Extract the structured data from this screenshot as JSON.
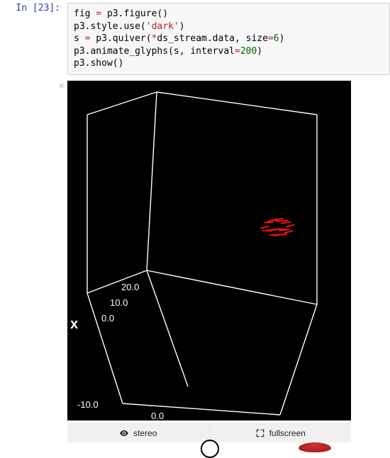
{
  "cell": {
    "prompt_in": "In ",
    "prompt_num": "23",
    "code": {
      "line1_a": "fig ",
      "line1_op": "=",
      "line1_b": " p3.figure()",
      "line2_a": "p3.style.use(",
      "line2_str": "'dark'",
      "line2_b": ")",
      "line3_a": "s ",
      "line3_op1": "=",
      "line3_b": " p3.quiver(",
      "line3_star": "*",
      "line3_c": "ds_stream.data, size",
      "line3_op2": "=",
      "line3_num": "6",
      "line3_d": ")",
      "line4_a": "p3.animate_glyphs(s, interval",
      "line4_op": "=",
      "line4_num": "200",
      "line4_b": ")",
      "line5": "p3.show()"
    }
  },
  "output": {
    "close_symbol": "×",
    "axis_ticks": {
      "t20": "20.0",
      "t10": "10.0",
      "t0": "0.0",
      "tm10": "-10.0",
      "bottom0": "0.0"
    },
    "axis_letter_x": "x",
    "toolbar": {
      "stereo": "stereo",
      "fullscreen": "fullscreen"
    }
  },
  "chart_data": {
    "type": "other",
    "description": "3D quiver/vector glyph plot (ipyvolume) on black background, dark style. A tight red cluster of small arrow glyphs near center-right of a white wireframe bounding cube. Visible axis tick labels along one edge: -10.0, 0.0, 10.0, 20.0 and an 'x' axis letter.",
    "axis_visible_ticks": [
      -10.0,
      0.0,
      10.0,
      20.0
    ],
    "glyph_cluster_approx_center_fraction": {
      "x": 0.72,
      "y": 0.41
    },
    "glyph_color": "#e11111",
    "background": "#000000",
    "cube_edge_color": "#ffffff"
  }
}
